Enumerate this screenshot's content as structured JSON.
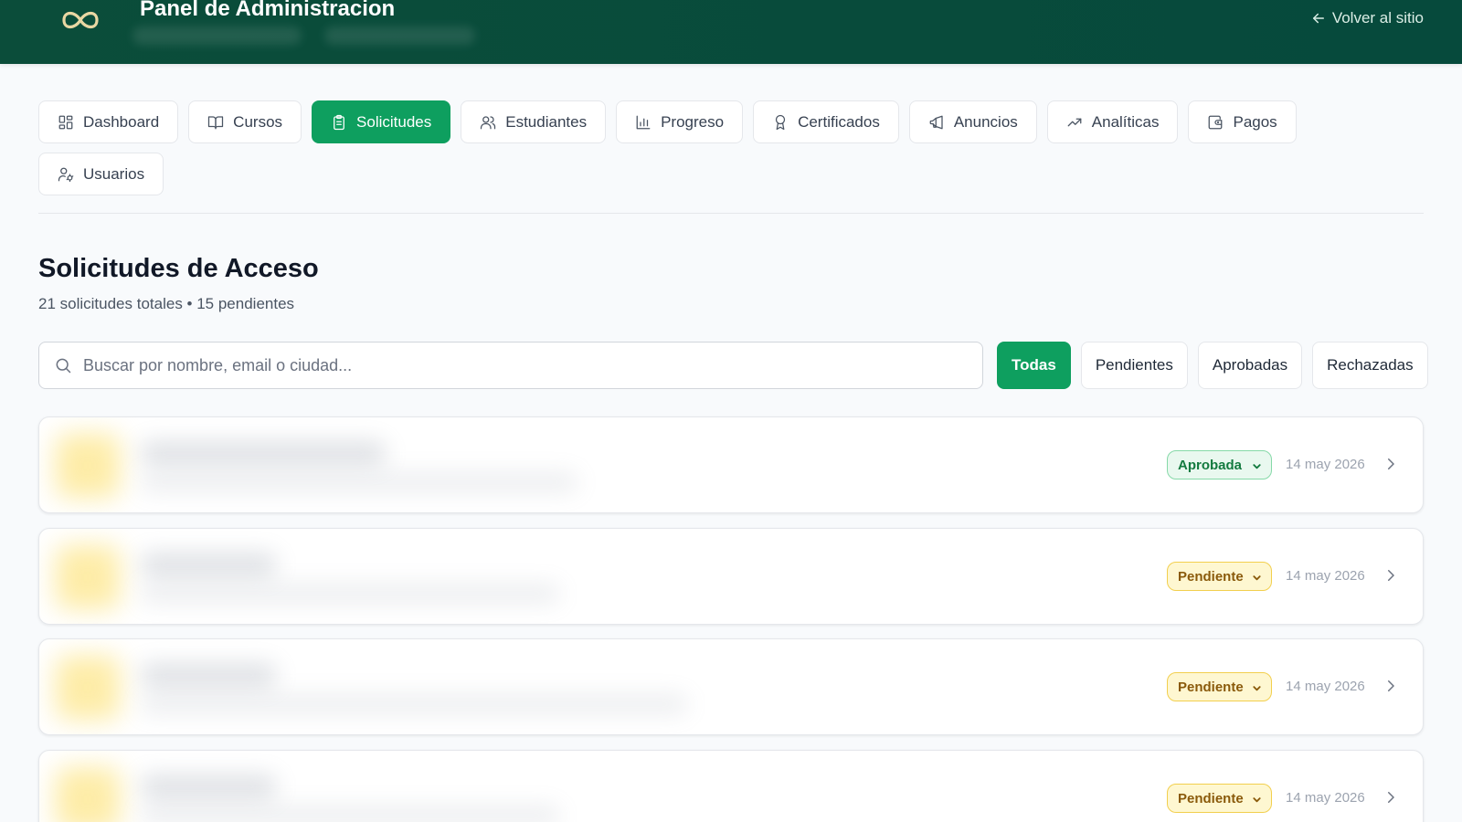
{
  "header": {
    "title": "Panel de Administracion",
    "back_label": "Volver al sitio",
    "colors": {
      "background": "#064a3c",
      "accent": "#0e9f5f"
    }
  },
  "tabs": [
    {
      "label": "Dashboard",
      "icon": "dashboard-grid-icon",
      "active": false
    },
    {
      "label": "Cursos",
      "icon": "book-icon",
      "active": false
    },
    {
      "label": "Solicitudes",
      "icon": "clipboard-icon",
      "active": true
    },
    {
      "label": "Estudiantes",
      "icon": "users-icon",
      "active": false
    },
    {
      "label": "Progreso",
      "icon": "bar-chart-icon",
      "active": false
    },
    {
      "label": "Certificados",
      "icon": "award-icon",
      "active": false
    },
    {
      "label": "Anuncios",
      "icon": "megaphone-icon",
      "active": false
    },
    {
      "label": "Analíticas",
      "icon": "trending-up-icon",
      "active": false
    },
    {
      "label": "Pagos",
      "icon": "wallet-icon",
      "active": false
    },
    {
      "label": "Usuarios",
      "icon": "user-cog-icon",
      "active": false
    }
  ],
  "page": {
    "title": "Solicitudes de Acceso",
    "subtitle": "21 solicitudes totales • 15 pendientes"
  },
  "search": {
    "placeholder": "Buscar por nombre, email o ciudad...",
    "value": ""
  },
  "filters": [
    {
      "label": "Todas",
      "active": true
    },
    {
      "label": "Pendientes",
      "active": false
    },
    {
      "label": "Aprobadas",
      "active": false
    },
    {
      "label": "Rechazadas",
      "active": false
    }
  ],
  "requests": [
    {
      "status": "Aprobada",
      "status_type": "aprobada",
      "date": "14 may 2026"
    },
    {
      "status": "Pendiente",
      "status_type": "pendiente",
      "date": "14 may 2026"
    },
    {
      "status": "Pendiente",
      "status_type": "pendiente",
      "date": "14 may 2026"
    },
    {
      "status": "Pendiente",
      "status_type": "pendiente",
      "date": "14 may 2026"
    }
  ],
  "status_colors": {
    "aprobada": "#137a3f",
    "pendiente": "#8a5a0b"
  }
}
